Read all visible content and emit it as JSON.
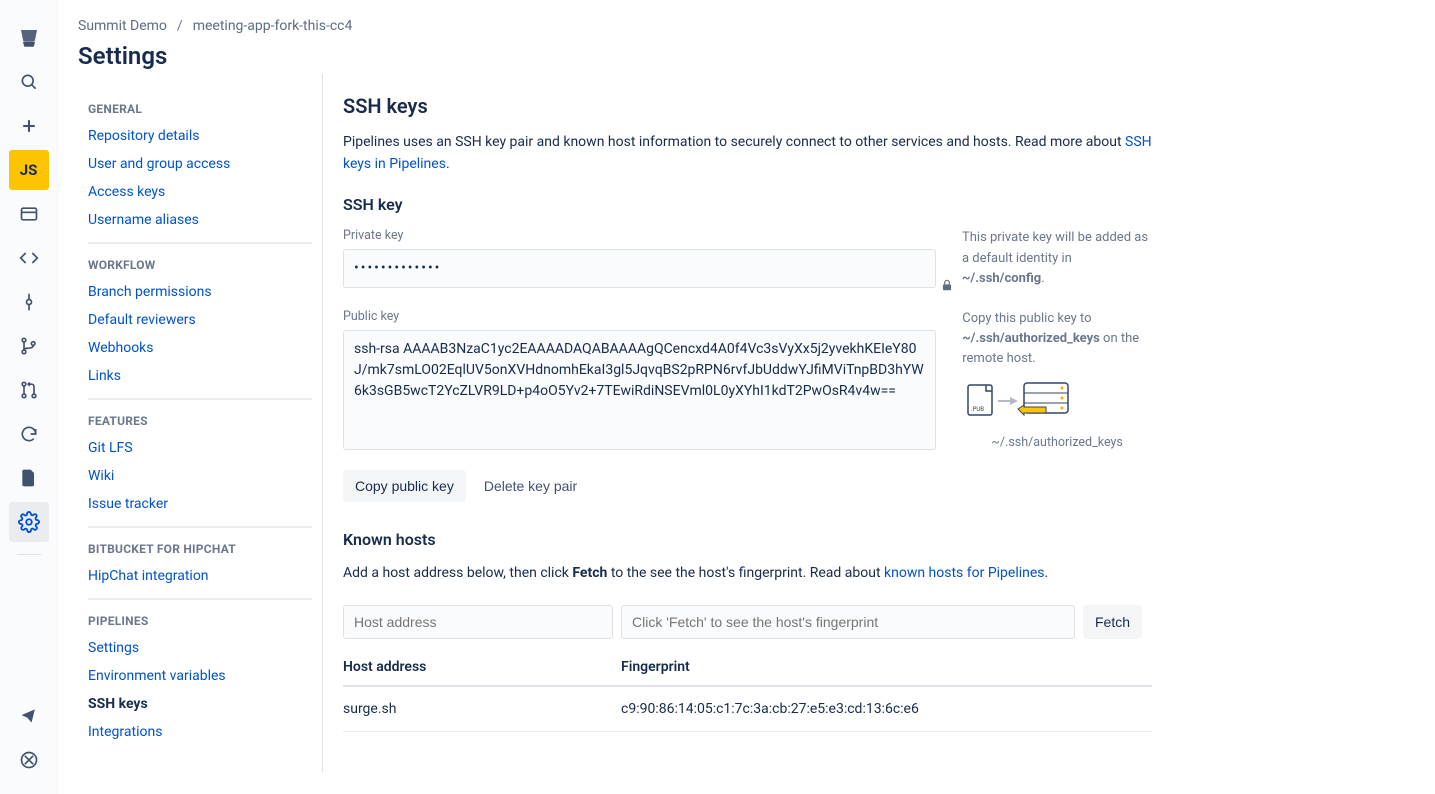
{
  "breadcrumb": {
    "project": "Summit Demo",
    "repo": "meeting-app-fork-this-cc4"
  },
  "page_title": "Settings",
  "rail": {
    "js": "JS"
  },
  "sidebar": {
    "general": {
      "heading": "GENERAL",
      "items": [
        "Repository details",
        "User and group access",
        "Access keys",
        "Username aliases"
      ]
    },
    "workflow": {
      "heading": "WORKFLOW",
      "items": [
        "Branch permissions",
        "Default reviewers",
        "Webhooks",
        "Links"
      ]
    },
    "features": {
      "heading": "FEATURES",
      "items": [
        "Git LFS",
        "Wiki",
        "Issue tracker"
      ]
    },
    "hipchat": {
      "heading": "BITBUCKET FOR HIPCHAT",
      "items": [
        "HipChat integration"
      ]
    },
    "pipelines": {
      "heading": "PIPELINES",
      "items": [
        "Settings",
        "Environment variables",
        "SSH keys",
        "Integrations"
      ],
      "current": "SSH keys"
    }
  },
  "ssh": {
    "title": "SSH keys",
    "intro_pre": "Pipelines uses an SSH key pair and known host information to securely connect to other services and hosts. Read more about ",
    "intro_link": "SSH keys in Pipelines",
    "subtitle": "SSH key",
    "private_label": "Private key",
    "private_value": "•••••••••••••",
    "private_hint_pre": "This private key will be added as a default identity in ",
    "private_hint_bold": "~/.ssh/config",
    "public_label": "Public key",
    "public_value": "ssh-rsa AAAAB3NzaC1yc2EAAAADAQABAAAAgQCencxd4A0f4Vc3sVyXx5j2yvekhKEIeY80J/mk7smLO02EqlUV5onXVHdnomhEkaI3gl5JqvqBS2pRPN6rvfJbUddwYJfiMViTnpBD3hYW6k3sGB5wcT2YcZLVR9LD+p4oO5Yv2+7TEwiRdiNSEVml0L0yXYhI1kdT2PwOsR4v4w==",
    "public_hint_pre": "Copy this public key to ",
    "public_hint_bold": "~/.ssh/authorized_keys",
    "public_hint_post": " on the remote host.",
    "illustration_caption": "~/.ssh/authorized_keys",
    "copy_btn": "Copy public key",
    "delete_btn": "Delete key pair"
  },
  "known": {
    "title": "Known hosts",
    "intro_pre": "Add a host address below, then click ",
    "intro_bold": "Fetch",
    "intro_post": " to the see the host's fingerprint. Read about ",
    "intro_link": "known hosts for Pipelines",
    "host_placeholder": "Host address",
    "fp_placeholder": "Click 'Fetch' to see the host's fingerprint",
    "fetch_btn": "Fetch",
    "table": {
      "col1": "Host address",
      "col2": "Fingerprint",
      "rows": [
        {
          "host": "surge.sh",
          "fp": "c9:90:86:14:05:c1:7c:3a:cb:27:e5:e3:cd:13:6c:e6"
        }
      ]
    }
  }
}
